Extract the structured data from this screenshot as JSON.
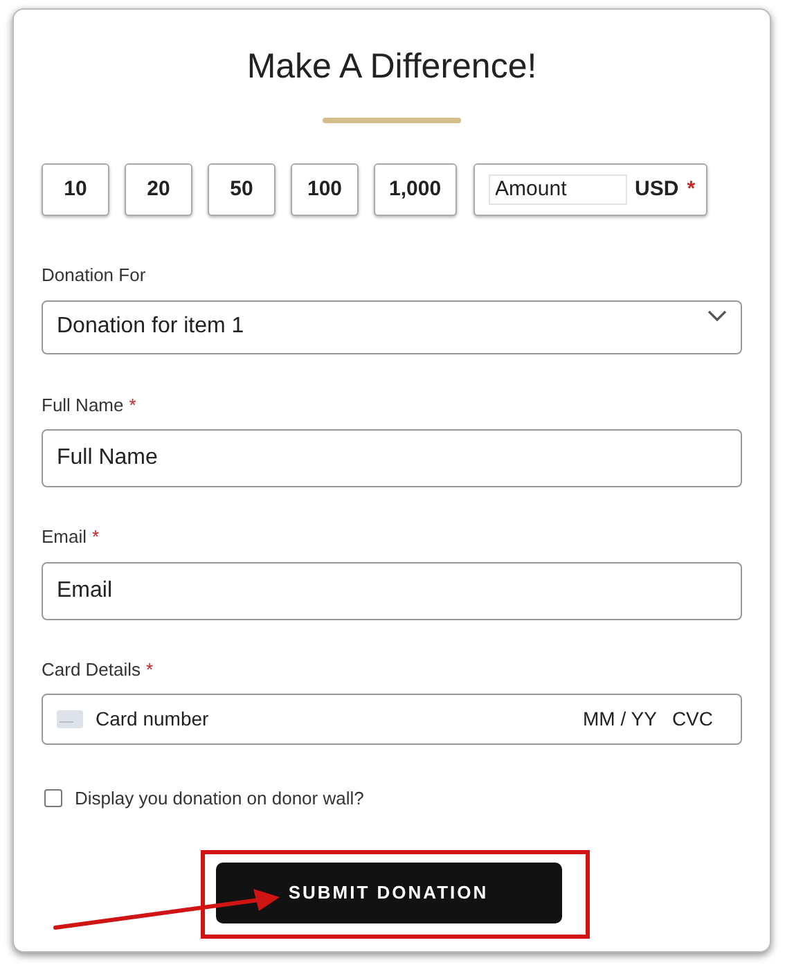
{
  "title": "Make A Difference!",
  "amounts": [
    {
      "label": "10"
    },
    {
      "label": "20"
    },
    {
      "label": "50"
    },
    {
      "label": "100"
    },
    {
      "label": "1,000"
    }
  ],
  "custom_amount": {
    "placeholder": "Amount",
    "currency": "USD",
    "required_mark": "*"
  },
  "fields": [
    {
      "kind": "select",
      "label": "Donation For",
      "value": "Donation for item 1"
    },
    {
      "kind": "text",
      "label": "Full Name",
      "required_mark": "*",
      "placeholder": "Full Name"
    },
    {
      "kind": "text",
      "label": "Email",
      "required_mark": "*",
      "placeholder": "Email"
    },
    {
      "kind": "card",
      "label": "Card Details",
      "required_mark": "*",
      "placeholder": "Card number",
      "expiry": "MM / YY",
      "cvc": "CVC"
    }
  ],
  "donor_wall": {
    "label": "Display you donation on donor wall?",
    "checked": false
  },
  "submit_button": "SUBMIT DONATION"
}
